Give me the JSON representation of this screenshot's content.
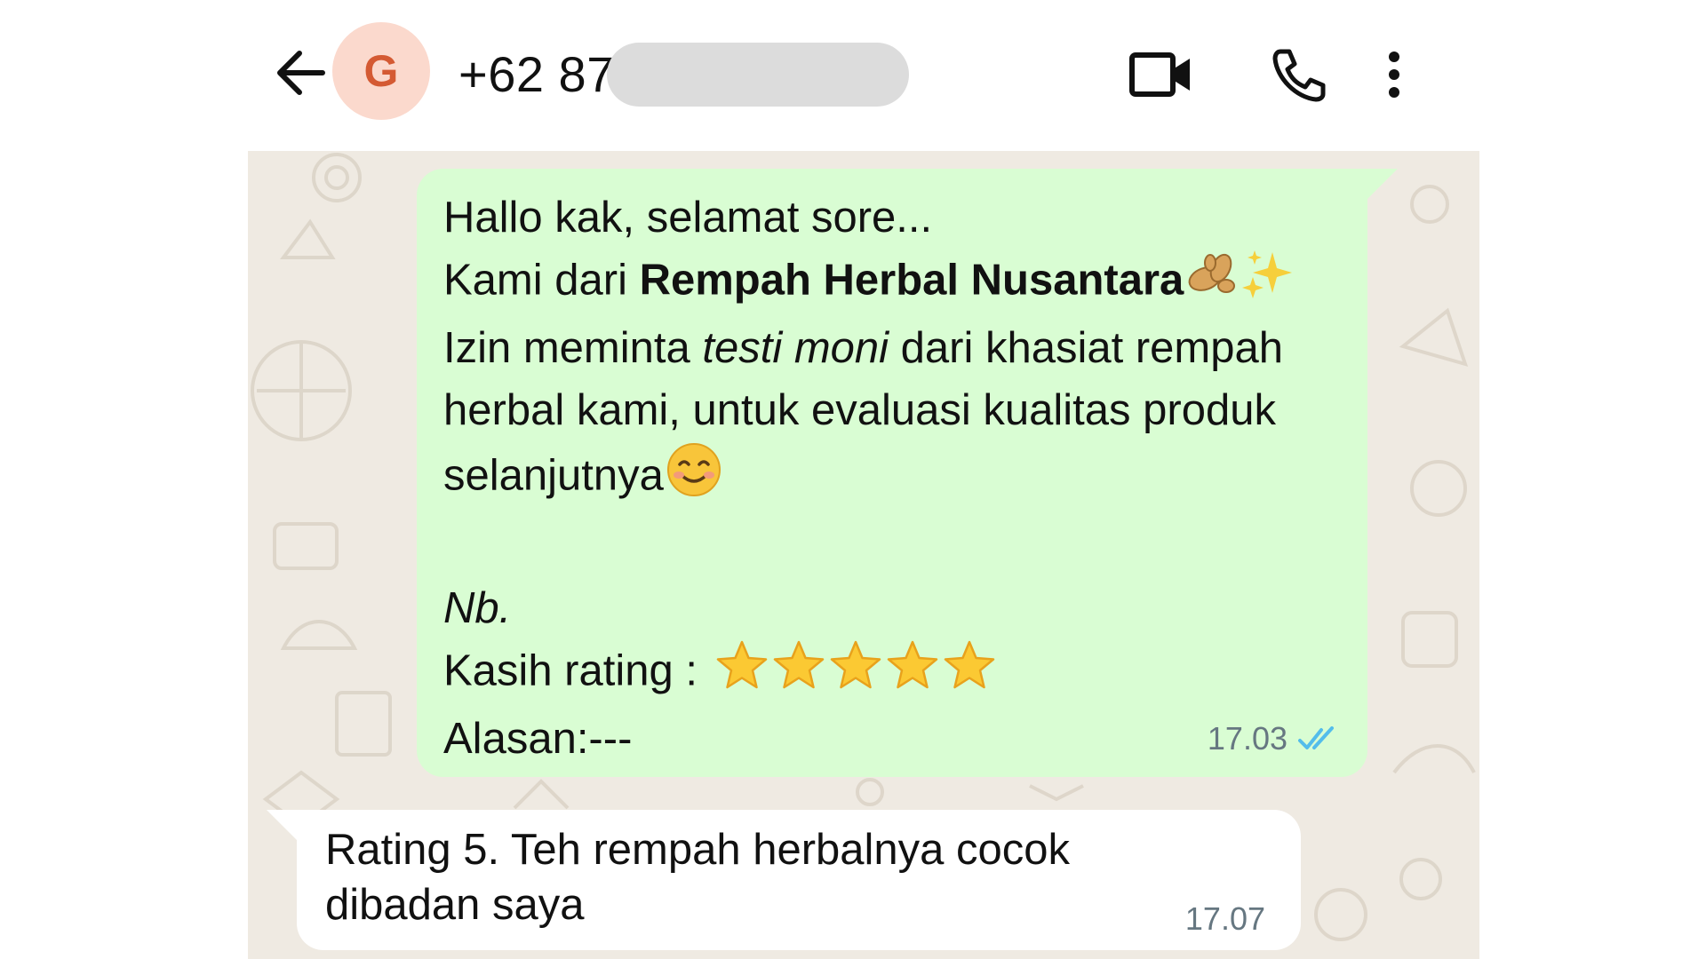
{
  "header": {
    "avatar_initial": "G",
    "contact_number": "+62 87",
    "icons": [
      "back-arrow-icon",
      "video-call-icon",
      "voice-call-icon",
      "more-options-icon"
    ],
    "avatar_bg": "#fbd9cd",
    "avatar_fg": "#d45a33"
  },
  "messages": {
    "outgoing": {
      "line1": "Hallo kak, selamat sore...",
      "line2_prefix": "Kami dari ",
      "line2_bold": "Rempah Herbal Nusantara",
      "line3_prefix": "Izin meminta ",
      "line3_italic": "testi moni",
      "line3_suffix": " dari khasiat rempah",
      "line4": "herbal kami, untuk evaluasi kualitas produk",
      "line5": "selanjutnya",
      "line6_italic": "Nb.",
      "line7": "Kasih rating : ",
      "line8": "Alasan:---",
      "rating_stars": 5,
      "time": "17.03",
      "status": "read",
      "bubble_color": "#d9fdd3",
      "tick_color": "#53bdeb"
    },
    "incoming": {
      "line1": "Rating 5. Teh rempah herbalnya cocok",
      "line2": "dibadan saya",
      "time": "17.07",
      "bubble_color": "#ffffff"
    }
  },
  "colors": {
    "chat_background": "#efeae2",
    "header_background": "#ffffff",
    "timestamp": "#667781"
  }
}
